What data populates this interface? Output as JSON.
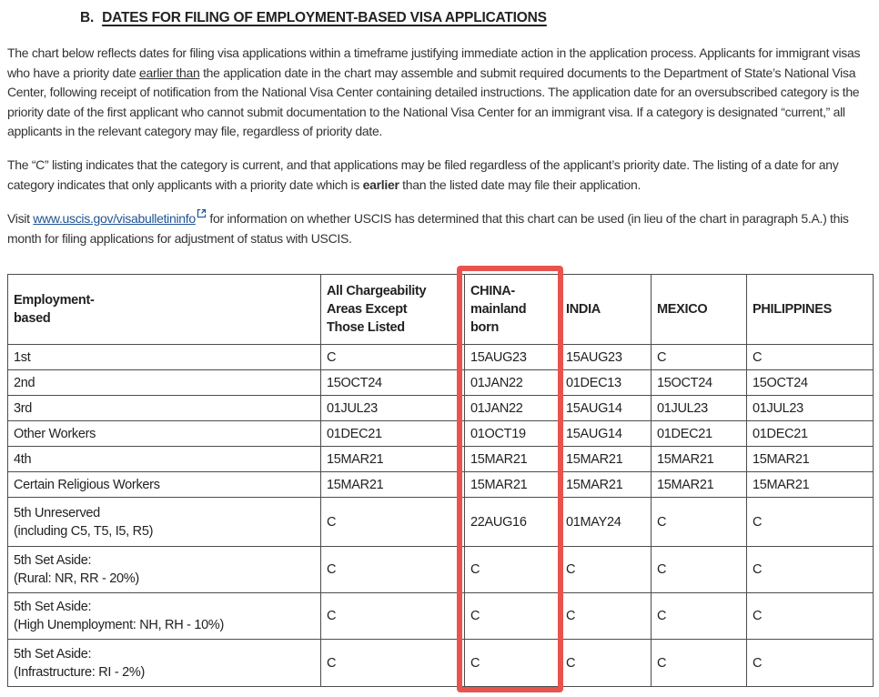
{
  "heading": {
    "prefix": "B.",
    "title": "DATES FOR FILING OF EMPLOYMENT-BASED VISA APPLICATIONS"
  },
  "paragraphs": {
    "p1": {
      "before": "The chart below reflects dates for filing visa applications within a timeframe justifying immediate action in the application process. Applicants for immigrant visas who have a priority date ",
      "underlined": "earlier than",
      "after": " the application date in the chart may assemble and submit required documents to the Department of State’s National Visa Center, following receipt of notification from the National Visa Center containing detailed instructions. The application date for an oversubscribed category is the priority date of the first applicant who cannot submit documentation to the National Visa Center for an immigrant visa. If a category is designated “current,” all applicants in the relevant category may file, regardless of priority date."
    },
    "p2": {
      "before": "The “C” listing indicates that the category is current, and that applications may be filed regardless of the applicant’s priority date. The listing of a date for any category indicates that only applicants with a priority date which is ",
      "bold": "earlier",
      "after": " than the listed date may file their application."
    },
    "p3": {
      "before": "Visit ",
      "link": "www.uscis.gov/visabulletininfo",
      "after": " for information on whether USCIS has determined that this chart can be used (in lieu of the chart in paragraph 5.A.) this month for filing applications for adjustment of status with USCIS."
    }
  },
  "table": {
    "column_headers": [
      "Employment-\nbased",
      "All Chargeability\nAreas Except\nThose Listed",
      "CHINA-\nmainland\nborn",
      "INDIA",
      "MEXICO",
      "PHILIPPINES"
    ],
    "rows": [
      {
        "category": "1st",
        "values": [
          "C",
          "15AUG23",
          "15AUG23",
          "C",
          "C"
        ]
      },
      {
        "category": "2nd",
        "values": [
          "15OCT24",
          "01JAN22",
          "01DEC13",
          "15OCT24",
          "15OCT24"
        ]
      },
      {
        "category": "3rd",
        "values": [
          "01JUL23",
          "01JAN22",
          "15AUG14",
          "01JUL23",
          "01JUL23"
        ]
      },
      {
        "category": "Other Workers",
        "values": [
          "01DEC21",
          "01OCT19",
          "15AUG14",
          "01DEC21",
          "01DEC21"
        ]
      },
      {
        "category": "4th",
        "values": [
          "15MAR21",
          "15MAR21",
          "15MAR21",
          "15MAR21",
          "15MAR21"
        ]
      },
      {
        "category": "Certain Religious Workers",
        "values": [
          "15MAR21",
          "15MAR21",
          "15MAR21",
          "15MAR21",
          "15MAR21"
        ]
      },
      {
        "category": "5th Unreserved\n(including C5, T5, I5, R5)",
        "values": [
          "C",
          "22AUG16",
          "01MAY24",
          "C",
          "C"
        ]
      },
      {
        "category": "5th Set Aside:\n(Rural: NR, RR - 20%)",
        "values": [
          "C",
          "C",
          "C",
          "C",
          "C"
        ]
      },
      {
        "category": "5th Set Aside:\n(High Unemployment: NH, RH - 10%)",
        "values": [
          "C",
          "C",
          "C",
          "C",
          "C"
        ]
      },
      {
        "category": "5th Set Aside:\n(Infrastructure: RI - 2%)",
        "values": [
          "C",
          "C",
          "C",
          "C",
          "C"
        ]
      }
    ]
  },
  "highlight": {
    "color": "#e8534e",
    "highlighted_column": "CHINA-mainland born"
  },
  "link_color": "#205493"
}
